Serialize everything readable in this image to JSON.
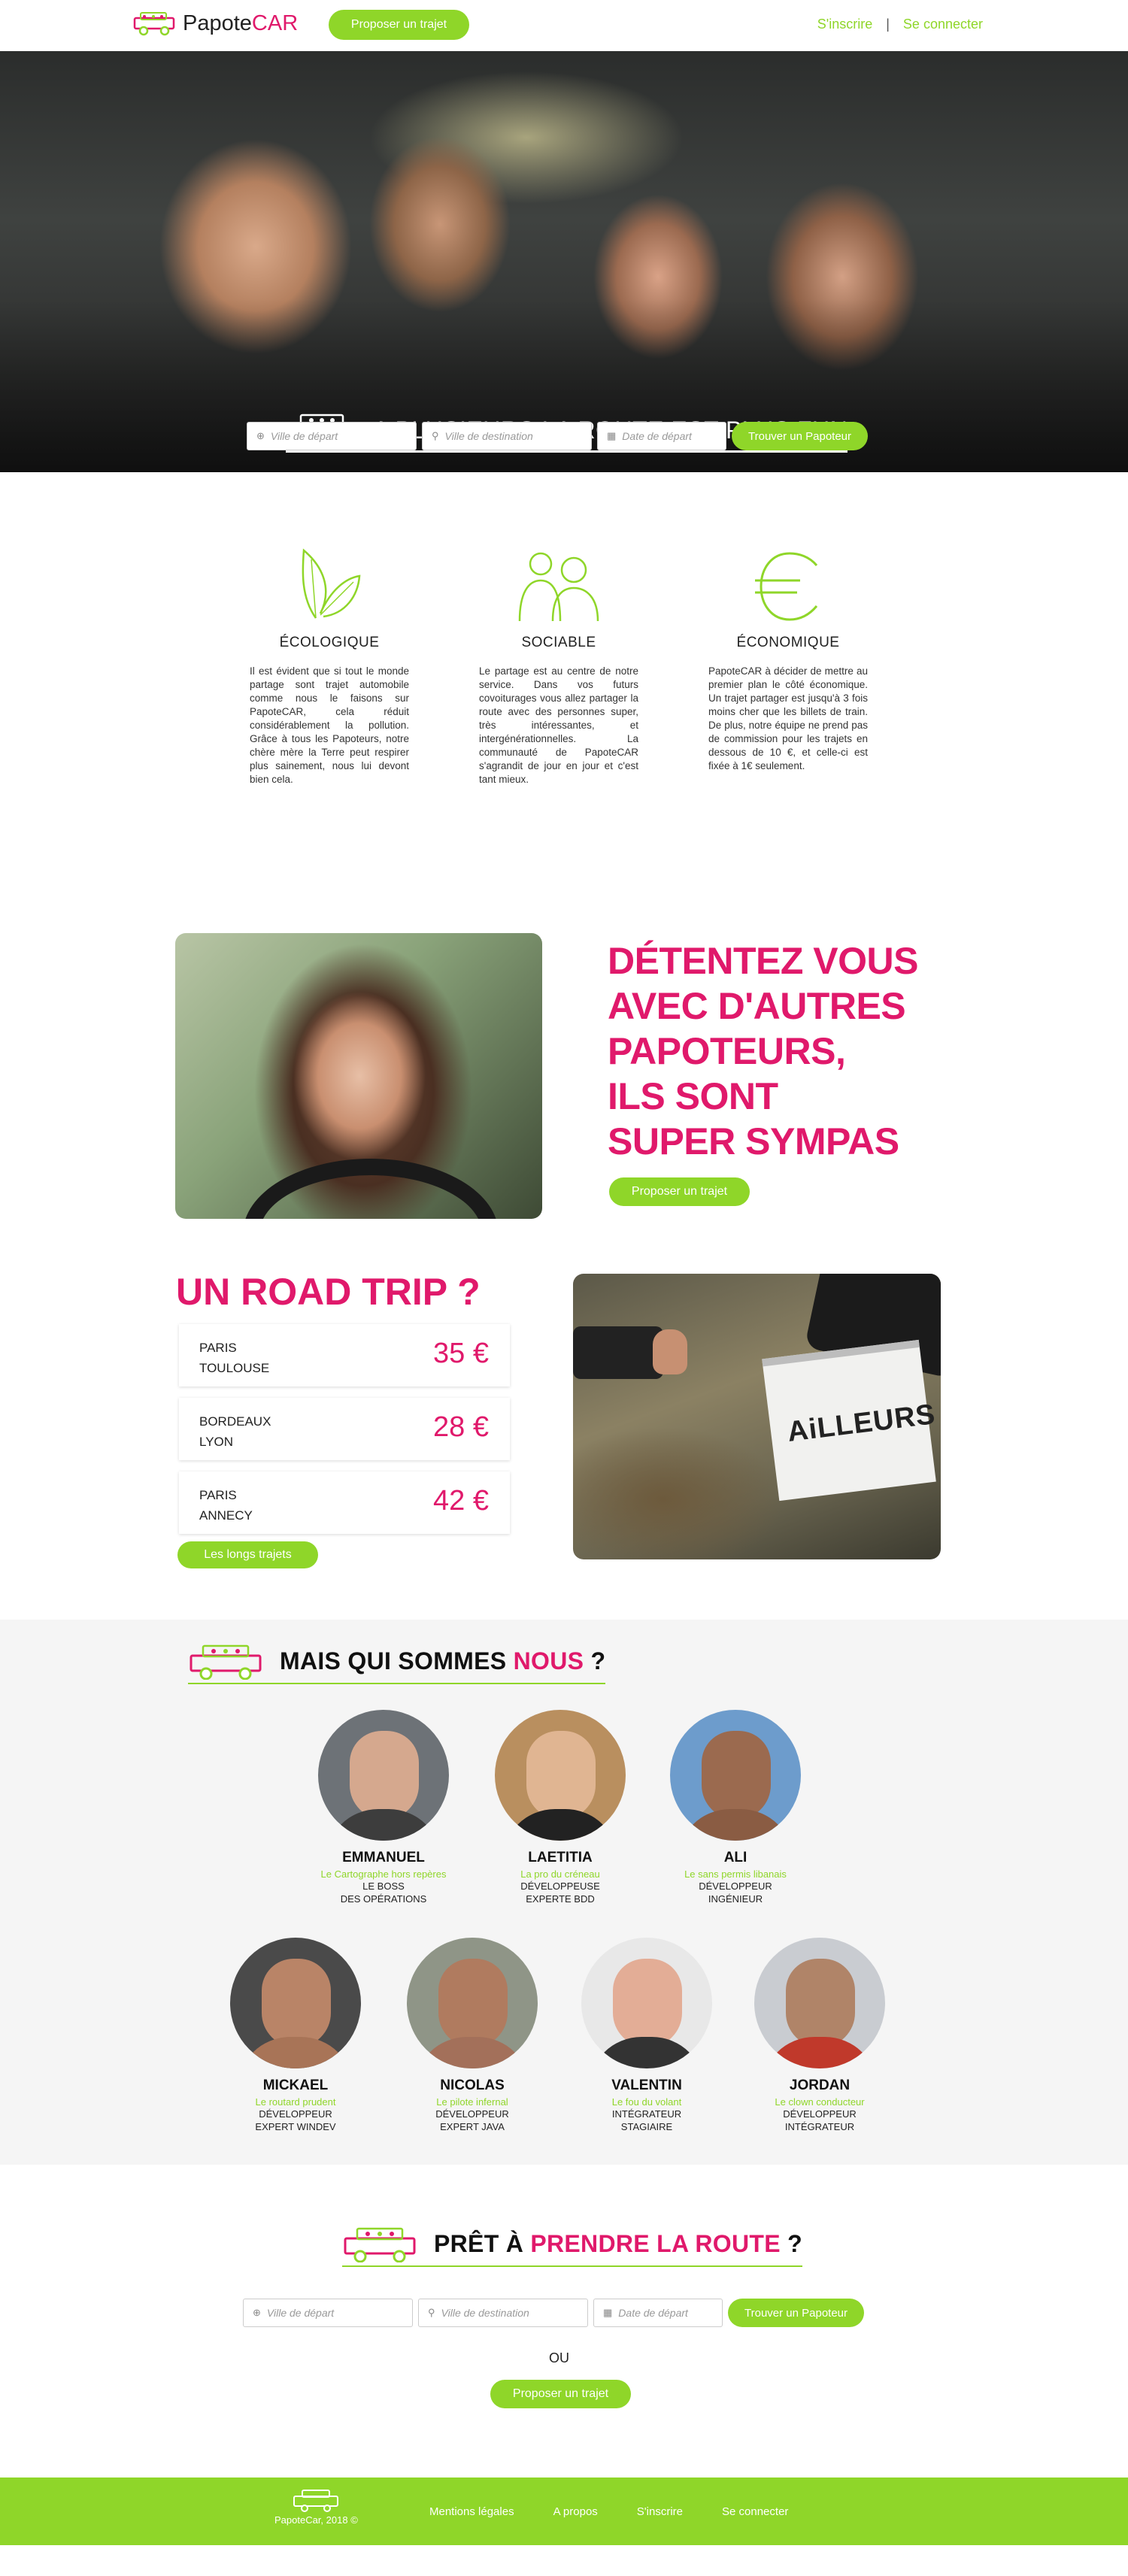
{
  "nav": {
    "logo_main": "Papote",
    "logo_accent": "CAR",
    "propose_label": "Proposer un trajet",
    "signup": "S'inscrire",
    "separator": "|",
    "login": "Se connecter"
  },
  "hero": {
    "title": "A PLUSIEURS LA ROUTE EST PLUS FUN"
  },
  "search": {
    "departure_placeholder": "Ville de départ",
    "destination_placeholder": "Ville de destination",
    "date_placeholder": "Date de départ",
    "submit_label": "Trouver un Papoteur"
  },
  "features": [
    {
      "title": "ÉCOLOGIQUE",
      "icon": "leaf-icon",
      "text": "Il est évident que si tout le monde partage sont trajet automobile comme nous le faisons sur PapoteCAR, cela réduit considérablement la pollution. Grâce à tous les Papoteurs, notre chère mère la Terre peut respirer plus sainement, nous lui devont bien cela."
    },
    {
      "title": "SOCIABLE",
      "icon": "people-icon",
      "text": "Le partage est au centre de notre service. Dans vos futurs covoiturages vous allez partager la route avec des personnes super, très intéressantes, et intergénérationnelles. La communauté de PapoteCAR s'agrandit de jour en jour et c'est tant mieux."
    },
    {
      "title": "ÉCONOMIQUE",
      "icon": "euro-icon",
      "text": "PapoteCAR à décider de mettre au premier plan le côté économique. Un trajet partager est jusqu'à 3 fois moins cher que les billets de train. De plus, notre équipe ne prend pas de commission pour les trajets en dessous de 10 €, et celle-ci est fixée à 1€ seulement."
    }
  ],
  "detente": {
    "heading_lines": [
      "DÉTENTEZ VOUS",
      "AVEC D'AUTRES",
      "PAPOTEURS,",
      "ILS SONT",
      "SUPER SYMPAS"
    ],
    "propose_label": "Proposer un trajet"
  },
  "roadtrip": {
    "heading": "UN ROAD TRIP ?",
    "trips": [
      {
        "from": "PARIS",
        "to": "TOULOUSE",
        "price": "35 €"
      },
      {
        "from": "BORDEAUX",
        "to": "LYON",
        "price": "28 €"
      },
      {
        "from": "PARIS",
        "to": "ANNECY",
        "price": "42 €"
      }
    ],
    "long_trips_label": "Les longs trajets",
    "sign_text": "AiLLEURS"
  },
  "team": {
    "heading_main": "MAIS QUI SOMMES ",
    "heading_accent": "NOUS",
    "heading_end": " ?",
    "members": [
      {
        "name": "EMMANUEL",
        "nick": "Le Cartographe hors repères",
        "role1": "LE BOSS",
        "role2": "DES OPÉRATIONS"
      },
      {
        "name": "LAETITIA",
        "nick": "La pro du créneau",
        "role1": "DÉVELOPPEUSE",
        "role2": "EXPERTE BDD"
      },
      {
        "name": "ALI",
        "nick": "Le sans permis libanais",
        "role1": "DÉVELOPPEUR",
        "role2": "INGÉNIEUR"
      },
      {
        "name": "MICKAEL",
        "nick": "Le routard prudent",
        "role1": "DÉVELOPPEUR",
        "role2": "EXPERT WINDEV"
      },
      {
        "name": "NICOLAS",
        "nick": "Le pilote infernal",
        "role1": "DÉVELOPPEUR",
        "role2": "EXPERT JAVA"
      },
      {
        "name": "VALENTIN",
        "nick": "Le fou du volant",
        "role1": "INTÉGRATEUR",
        "role2": "STAGIAIRE"
      },
      {
        "name": "JORDAN",
        "nick": "Le clown conducteur",
        "role1": "DÉVELOPPEUR",
        "role2": "INTÉGRATEUR"
      }
    ]
  },
  "cta": {
    "heading_main": "PRÊT À ",
    "heading_accent": "PRENDRE LA ROUTE",
    "heading_end": " ?",
    "or_label": "OU",
    "propose_label": "Proposer un trajet"
  },
  "footer": {
    "copyright": "PapoteCar, 2018 ©",
    "links": [
      "Mentions légales",
      "A propos",
      "S'inscrire",
      "Se connecter"
    ]
  },
  "colors": {
    "accent_green": "#8fd629",
    "accent_pink": "#e0196b"
  }
}
